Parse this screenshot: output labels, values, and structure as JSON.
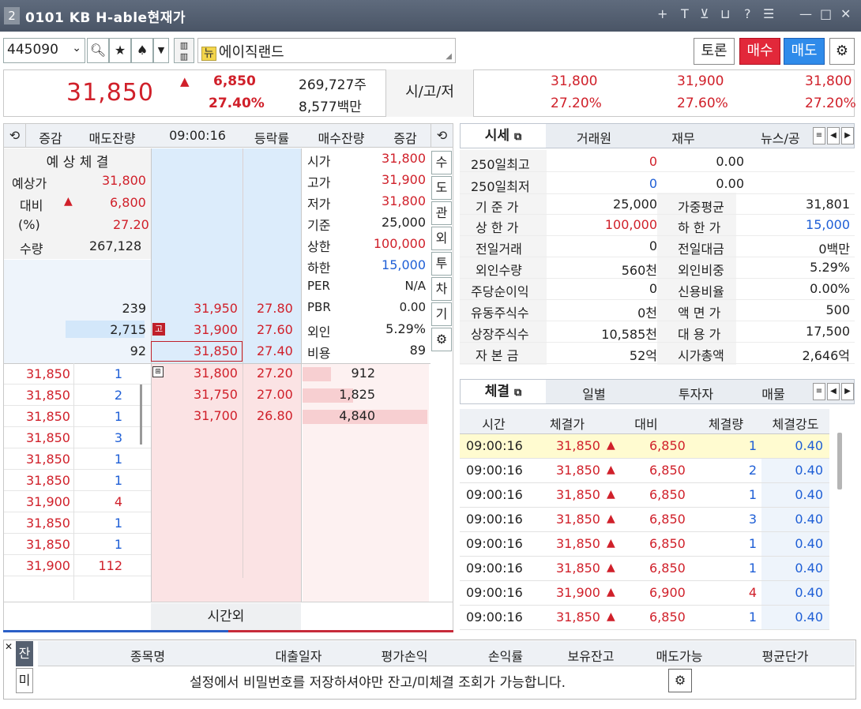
{
  "window": {
    "number": "2",
    "title": "0101 KB H-able현재가",
    "controls": [
      "+",
      "T",
      "⊻",
      "⊔",
      "?",
      "☰",
      "—",
      "□",
      "✕"
    ]
  },
  "toolbar": {
    "code": "445090",
    "stock_badge": "뉴",
    "stock_name": "에이직랜드",
    "btn_forum": "토론",
    "btn_buy": "매수",
    "btn_sell": "매도"
  },
  "price": {
    "current": "31,850",
    "change": "6,850",
    "change_pct": "27.40%",
    "volume": "269,727주",
    "amount": "8,577백만",
    "sigoje": "시/고/저",
    "open": "31,800",
    "high": "31,900",
    "low": "31,800",
    "open_pct": "27.20%",
    "high_pct": "27.60%",
    "low_pct": "27.20%"
  },
  "orderbook": {
    "headers": [
      "증감",
      "매도잔량",
      "09:00:16",
      "등락률",
      "매수잔량",
      "증감"
    ],
    "expected": {
      "title": "예 상 체 결",
      "rows": [
        {
          "k": "예상가",
          "v": "31,800"
        },
        {
          "k": "대비",
          "v": "6,800"
        },
        {
          "k": "(%)",
          "v": "27.20"
        },
        {
          "k": "수량",
          "v": "267,128"
        }
      ]
    },
    "info": [
      {
        "k": "시가",
        "v": "31,800"
      },
      {
        "k": "고가",
        "v": "31,900"
      },
      {
        "k": "저가",
        "v": "31,800"
      },
      {
        "k": "기준",
        "v": "25,000"
      },
      {
        "k": "상한",
        "v": "100,000"
      },
      {
        "k": "하한",
        "v": "15,000"
      },
      {
        "k": "PER",
        "v": "N/A"
      },
      {
        "k": "PBR",
        "v": "0.00"
      },
      {
        "k": "외인",
        "v": "5.29%"
      },
      {
        "k": "비용",
        "v": "89"
      }
    ],
    "asks": [
      {
        "qty": "239",
        "price": "31,950",
        "pct": "27.80"
      },
      {
        "qty": "2,715",
        "price": "31,900",
        "pct": "27.60",
        "badge": "고"
      },
      {
        "qty": "92",
        "price": "31,850",
        "pct": "27.40"
      }
    ],
    "bids": [
      {
        "price": "31,800",
        "pct": "27.20",
        "qty": "912"
      },
      {
        "price": "31,750",
        "pct": "27.00",
        "qty": "1,825"
      },
      {
        "price": "31,700",
        "pct": "26.80",
        "qty": "4,840"
      }
    ],
    "ticks": [
      {
        "p": "31,850",
        "q": "1"
      },
      {
        "p": "31,850",
        "q": "2"
      },
      {
        "p": "31,850",
        "q": "1"
      },
      {
        "p": "31,850",
        "q": "3"
      },
      {
        "p": "31,850",
        "q": "1"
      },
      {
        "p": "31,850",
        "q": "1"
      },
      {
        "p": "31,900",
        "q": "4"
      },
      {
        "p": "31,850",
        "q": "1"
      },
      {
        "p": "31,850",
        "q": "1"
      },
      {
        "p": "31,900",
        "q": "112"
      }
    ],
    "side_buttons": [
      "수",
      "도",
      "관",
      "외",
      "투",
      "차",
      "기"
    ],
    "after_hours": "시간외"
  },
  "market": {
    "tabs": [
      "시세",
      "거래원",
      "재무",
      "뉴스/공"
    ],
    "rows": [
      {
        "k1": "250일최고",
        "v1": "0",
        "v1b": "0.00",
        "k2": "",
        "v2": ""
      },
      {
        "k1": "250일최저",
        "v1": "0",
        "v1b": "0.00",
        "k2": "",
        "v2": ""
      },
      {
        "k1": "기 준 가",
        "v1": "25,000",
        "k2": "가중평균",
        "v2": "31,801"
      },
      {
        "k1": "상 한 가",
        "v1": "100,000",
        "k2": "하 한 가",
        "v2": "15,000"
      },
      {
        "k1": "전일거래",
        "v1": "0",
        "k2": "전일대금",
        "v2": "0백만"
      },
      {
        "k1": "외인수량",
        "v1": "560천",
        "k2": "외인비중",
        "v2": "5.29%"
      },
      {
        "k1": "주당순이익",
        "v1": "0",
        "k2": "신용비율",
        "v2": "0.00%"
      },
      {
        "k1": "유동주식수",
        "v1": "0천",
        "k2": "액 면 가",
        "v2": "500"
      },
      {
        "k1": "상장주식수",
        "v1": "10,585천",
        "k2": "대 용 가",
        "v2": "17,500"
      },
      {
        "k1": "자 본 금",
        "v1": "52억",
        "k2": "시가총액",
        "v2": "2,646억"
      }
    ]
  },
  "trades": {
    "tabs": [
      "체결",
      "일별",
      "투자자",
      "매물"
    ],
    "headers": [
      "시간",
      "체결가",
      "대비",
      "체결량",
      "체결강도"
    ],
    "rows": [
      {
        "t": "09:00:16",
        "p": "31,850",
        "d": "6,850",
        "q": "1",
        "s": "0.40"
      },
      {
        "t": "09:00:16",
        "p": "31,850",
        "d": "6,850",
        "q": "2",
        "s": "0.40"
      },
      {
        "t": "09:00:16",
        "p": "31,850",
        "d": "6,850",
        "q": "1",
        "s": "0.40"
      },
      {
        "t": "09:00:16",
        "p": "31,850",
        "d": "6,850",
        "q": "3",
        "s": "0.40"
      },
      {
        "t": "09:00:16",
        "p": "31,850",
        "d": "6,850",
        "q": "1",
        "s": "0.40"
      },
      {
        "t": "09:00:16",
        "p": "31,850",
        "d": "6,850",
        "q": "1",
        "s": "0.40"
      },
      {
        "t": "09:00:16",
        "p": "31,900",
        "d": "6,900",
        "q": "4",
        "s": "0.40"
      },
      {
        "t": "09:00:16",
        "p": "31,850",
        "d": "6,850",
        "q": "1",
        "s": "0.40"
      }
    ]
  },
  "balance": {
    "side": [
      "잔",
      "미"
    ],
    "headers": [
      "종목명",
      "대출일자",
      "평가손익",
      "손익률",
      "보유잔고",
      "매도가능",
      "평균단가"
    ],
    "message": "설정에서 비밀번호를 저장하셔야만 잔고/미체결 조회가 가능합니다."
  },
  "colors": {
    "up": "#d0202a",
    "down": "#1f5fd6",
    "ask_bg": "#dcecfb",
    "bid_bg": "#fbe3e4"
  }
}
